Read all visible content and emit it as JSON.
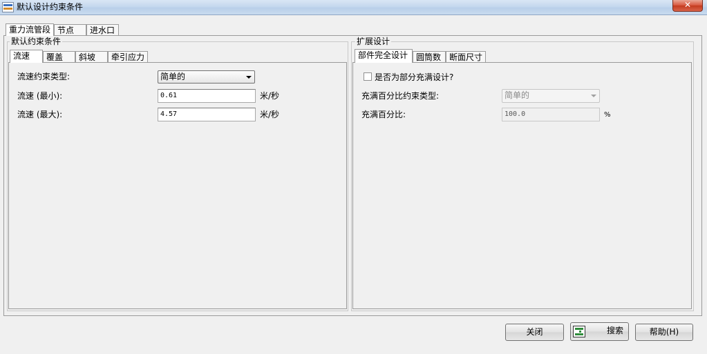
{
  "window": {
    "title": "默认设计约束条件",
    "close_glyph": "✕"
  },
  "main_tabs": [
    {
      "label": "重力流管段",
      "active": true
    },
    {
      "label": "节点",
      "active": false
    },
    {
      "label": "进水口",
      "active": false
    }
  ],
  "left_group": {
    "title": "默认约束条件",
    "tabs": [
      {
        "label": "流速",
        "active": true
      },
      {
        "label": "覆盖",
        "active": false
      },
      {
        "label": "斜坡",
        "active": false
      },
      {
        "label": "牵引应力",
        "active": false
      }
    ],
    "constraint_type_label": "流速约束类型:",
    "constraint_type_value": "简单的",
    "min_label": "流速 (最小):",
    "min_value": "0.61",
    "min_unit": "米/秒",
    "max_label": "流速 (最大):",
    "max_value": "4.57",
    "max_unit": "米/秒"
  },
  "right_group": {
    "title": "扩展设计",
    "tabs": [
      {
        "label": "部件完全设计",
        "active": true
      },
      {
        "label": "圆筒数",
        "active": false
      },
      {
        "label": "断面尺寸",
        "active": false
      }
    ],
    "partial_full_checkbox_label": "是否为部分充满设计?",
    "partial_full_checked": false,
    "percent_type_label": "充满百分比约束类型:",
    "percent_type_value": "简单的",
    "percent_label": "充满百分比:",
    "percent_value": "100.0",
    "percent_unit": "%"
  },
  "buttons": {
    "close": "关闭",
    "search": "搜索",
    "help": "帮助(H)"
  },
  "icons": {
    "app": "ruler-icon",
    "search": "search-logo-icon"
  },
  "colors": {
    "titlebar": "#c5d8ee",
    "close_button": "#d7553c",
    "window_bg": "#f0f0f0",
    "search_icon": "#2e8b3a"
  }
}
